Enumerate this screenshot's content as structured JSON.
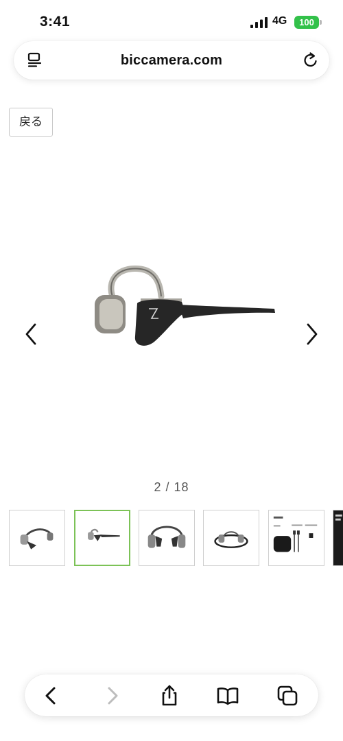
{
  "status_bar": {
    "time": "3:41",
    "network": "4G",
    "battery": "100"
  },
  "address_bar": {
    "url": "biccamera.com",
    "reader_icon": "reader-icon",
    "reload_icon": "reload-icon"
  },
  "back_link": {
    "label": "戻る"
  },
  "gallery": {
    "counter": "2 / 18",
    "prev_icon": "chevron-left-icon",
    "next_icon": "chevron-right-icon",
    "thumbnails": [
      {
        "index": 1,
        "active": false
      },
      {
        "index": 2,
        "active": true
      },
      {
        "index": 3,
        "active": false
      },
      {
        "index": 4,
        "active": false
      },
      {
        "index": 5,
        "active": false
      },
      {
        "index": 6,
        "active": false
      }
    ]
  },
  "toolbar": {
    "items": [
      "back-icon",
      "forward-icon",
      "share-icon",
      "bookmarks-icon",
      "tabs-icon"
    ]
  },
  "colors": {
    "accent_active_thumb": "#7cc257",
    "battery": "#33c14a"
  }
}
